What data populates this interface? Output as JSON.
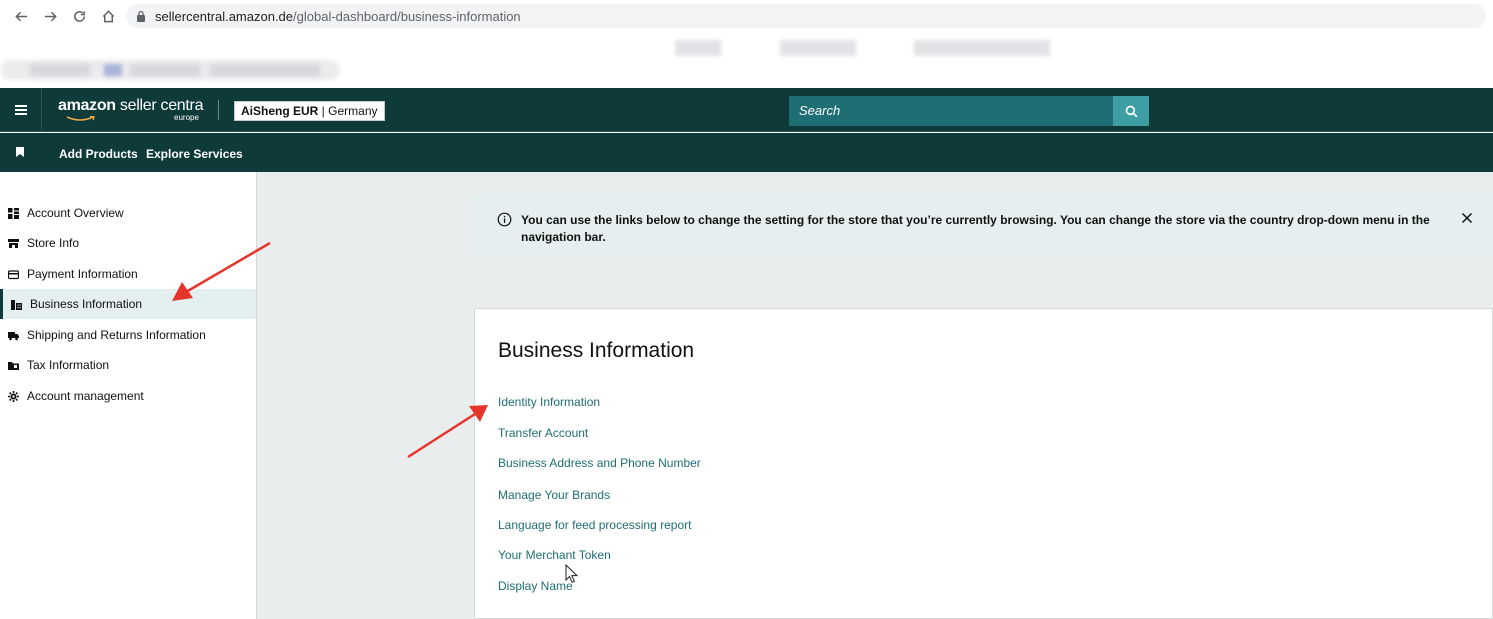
{
  "browser": {
    "url_host": "sellercentral.amazon.de",
    "url_path": "/global-dashboard/business-information"
  },
  "header": {
    "logo_part1": "amazon",
    "logo_part2": " seller centra",
    "logo_region": "europe",
    "store_name": "AiSheng EUR",
    "store_separator": " | ",
    "store_country": "Germany",
    "search_placeholder": "Search"
  },
  "subnav": {
    "items": [
      {
        "label": "Add Products"
      },
      {
        "label": "Explore Services"
      }
    ]
  },
  "sidebar": {
    "items": [
      {
        "label": "Account Overview",
        "icon": "grid-icon",
        "active": false
      },
      {
        "label": "Store Info",
        "icon": "store-icon",
        "active": false
      },
      {
        "label": "Payment Information",
        "icon": "card-icon",
        "active": false
      },
      {
        "label": "Business Information",
        "icon": "building-icon",
        "active": true
      },
      {
        "label": "Shipping and Returns Information",
        "icon": "truck-icon",
        "active": false
      },
      {
        "label": "Tax Information",
        "icon": "folder-icon",
        "active": false
      },
      {
        "label": "Account management",
        "icon": "gear-icon",
        "active": false
      }
    ]
  },
  "banner": {
    "text": "You can use the links below to change the setting for the store that you’re currently browsing. You can change the store via the country drop-down menu in the navigation bar."
  },
  "card": {
    "title": "Business Information",
    "links": [
      {
        "label": "Identity Information"
      },
      {
        "label": "Transfer Account"
      },
      {
        "label": "Business Address and Phone Number"
      },
      {
        "label": "Manage Your Brands"
      },
      {
        "label": "Language for feed processing report"
      },
      {
        "label": "Your Merchant Token"
      },
      {
        "label": "Display Name"
      }
    ]
  },
  "colors": {
    "header_bg": "#0f3a3a",
    "search_bg": "#1f6e74",
    "search_btn": "#3d9ea3",
    "link": "#1f6e74",
    "annotation_arrow": "#e8352b",
    "active_sidebar_bg": "#e4f0ef"
  }
}
